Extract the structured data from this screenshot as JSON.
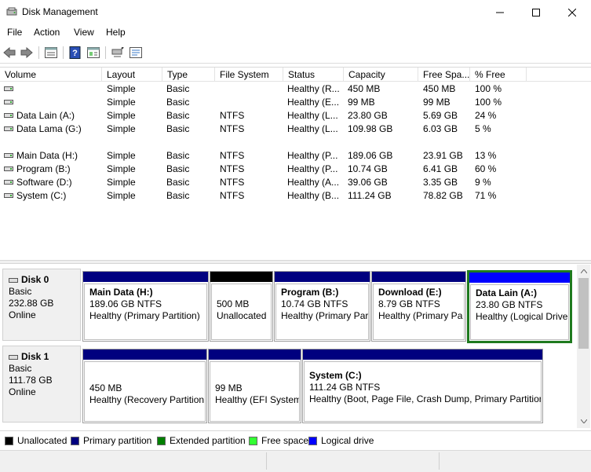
{
  "window": {
    "title": "Disk Management"
  },
  "menu": [
    "File",
    "Action",
    "View",
    "Help"
  ],
  "toolbar": [
    "back-arrow-icon",
    "forward-arrow-icon",
    "list-view-icon",
    "help-icon",
    "properties-icon",
    "connect-icon",
    "settings-icon"
  ],
  "columns": [
    "Volume",
    "Layout",
    "Type",
    "File System",
    "Status",
    "Capacity",
    "Free Spa...",
    "% Free"
  ],
  "volumes": [
    {
      "volume": "",
      "layout": "Simple",
      "type": "Basic",
      "fs": "",
      "status": "Healthy (R...",
      "capacity": "450 MB",
      "free": "450 MB",
      "pct": "100 %"
    },
    {
      "volume": "",
      "layout": "Simple",
      "type": "Basic",
      "fs": "",
      "status": "Healthy (E...",
      "capacity": "99 MB",
      "free": "99 MB",
      "pct": "100 %"
    },
    {
      "volume": "Data Lain (A:)",
      "layout": "Simple",
      "type": "Basic",
      "fs": "NTFS",
      "status": "Healthy (L...",
      "capacity": "23.80 GB",
      "free": "5.69 GB",
      "pct": "24 %"
    },
    {
      "volume": "Data Lama (G:)",
      "layout": "Simple",
      "type": "Basic",
      "fs": "NTFS",
      "status": "Healthy (L...",
      "capacity": "109.98 GB",
      "free": "6.03 GB",
      "pct": "5 %"
    },
    {
      "volume": "Main Data (H:)",
      "layout": "Simple",
      "type": "Basic",
      "fs": "NTFS",
      "status": "Healthy (P...",
      "capacity": "189.06 GB",
      "free": "23.91 GB",
      "pct": "13 %"
    },
    {
      "volume": "Program (B:)",
      "layout": "Simple",
      "type": "Basic",
      "fs": "NTFS",
      "status": "Healthy (P...",
      "capacity": "10.74 GB",
      "free": "6.41 GB",
      "pct": "60 %"
    },
    {
      "volume": "Software (D:)",
      "layout": "Simple",
      "type": "Basic",
      "fs": "NTFS",
      "status": "Healthy (A...",
      "capacity": "39.06 GB",
      "free": "3.35 GB",
      "pct": "9 %"
    },
    {
      "volume": "System (C:)",
      "layout": "Simple",
      "type": "Basic",
      "fs": "NTFS",
      "status": "Healthy (B...",
      "capacity": "111.24 GB",
      "free": "78.82 GB",
      "pct": "71 %"
    }
  ],
  "disks": [
    {
      "name": "Disk 0",
      "type": "Basic",
      "size": "232.88 GB",
      "state": "Online",
      "partitions": [
        {
          "name": "Main Data  (H:)",
          "line1": "189.06 GB NTFS",
          "line2": "Healthy (Primary Partition)",
          "color": "#00007f"
        },
        {
          "name": "",
          "line1": "500 MB",
          "line2": "Unallocated",
          "color": "#000000"
        },
        {
          "name": "Program  (B:)",
          "line1": "10.74 GB NTFS",
          "line2": "Healthy (Primary Par",
          "color": "#00007f"
        },
        {
          "name": "Download  (E:)",
          "line1": "8.79 GB NTFS",
          "line2": "Healthy (Primary Pa",
          "color": "#00007f"
        },
        {
          "name": "Data Lain  (A:)",
          "line1": "23.80 GB NTFS",
          "line2": "Healthy (Logical Drive",
          "color": "#0000ff"
        }
      ]
    },
    {
      "name": "Disk 1",
      "type": "Basic",
      "size": "111.78 GB",
      "state": "Online",
      "partitions": [
        {
          "name": "",
          "line1": "450 MB",
          "line2": "Healthy (Recovery Partition",
          "color": "#00007f"
        },
        {
          "name": "",
          "line1": "99 MB",
          "line2": "Healthy (EFI System",
          "color": "#00007f"
        },
        {
          "name": "System  (C:)",
          "line1": "111.24 GB NTFS",
          "line2": "Healthy (Boot, Page File, Crash Dump, Primary Partition",
          "color": "#00007f"
        }
      ]
    }
  ],
  "legend": [
    {
      "label": "Unallocated",
      "color": "#000000"
    },
    {
      "label": "Primary partition",
      "color": "#00007f"
    },
    {
      "label": "Extended partition",
      "color": "#007f00"
    },
    {
      "label": "Free space",
      "color": "#33ff33"
    },
    {
      "label": "Logical drive",
      "color": "#0000ff"
    }
  ]
}
